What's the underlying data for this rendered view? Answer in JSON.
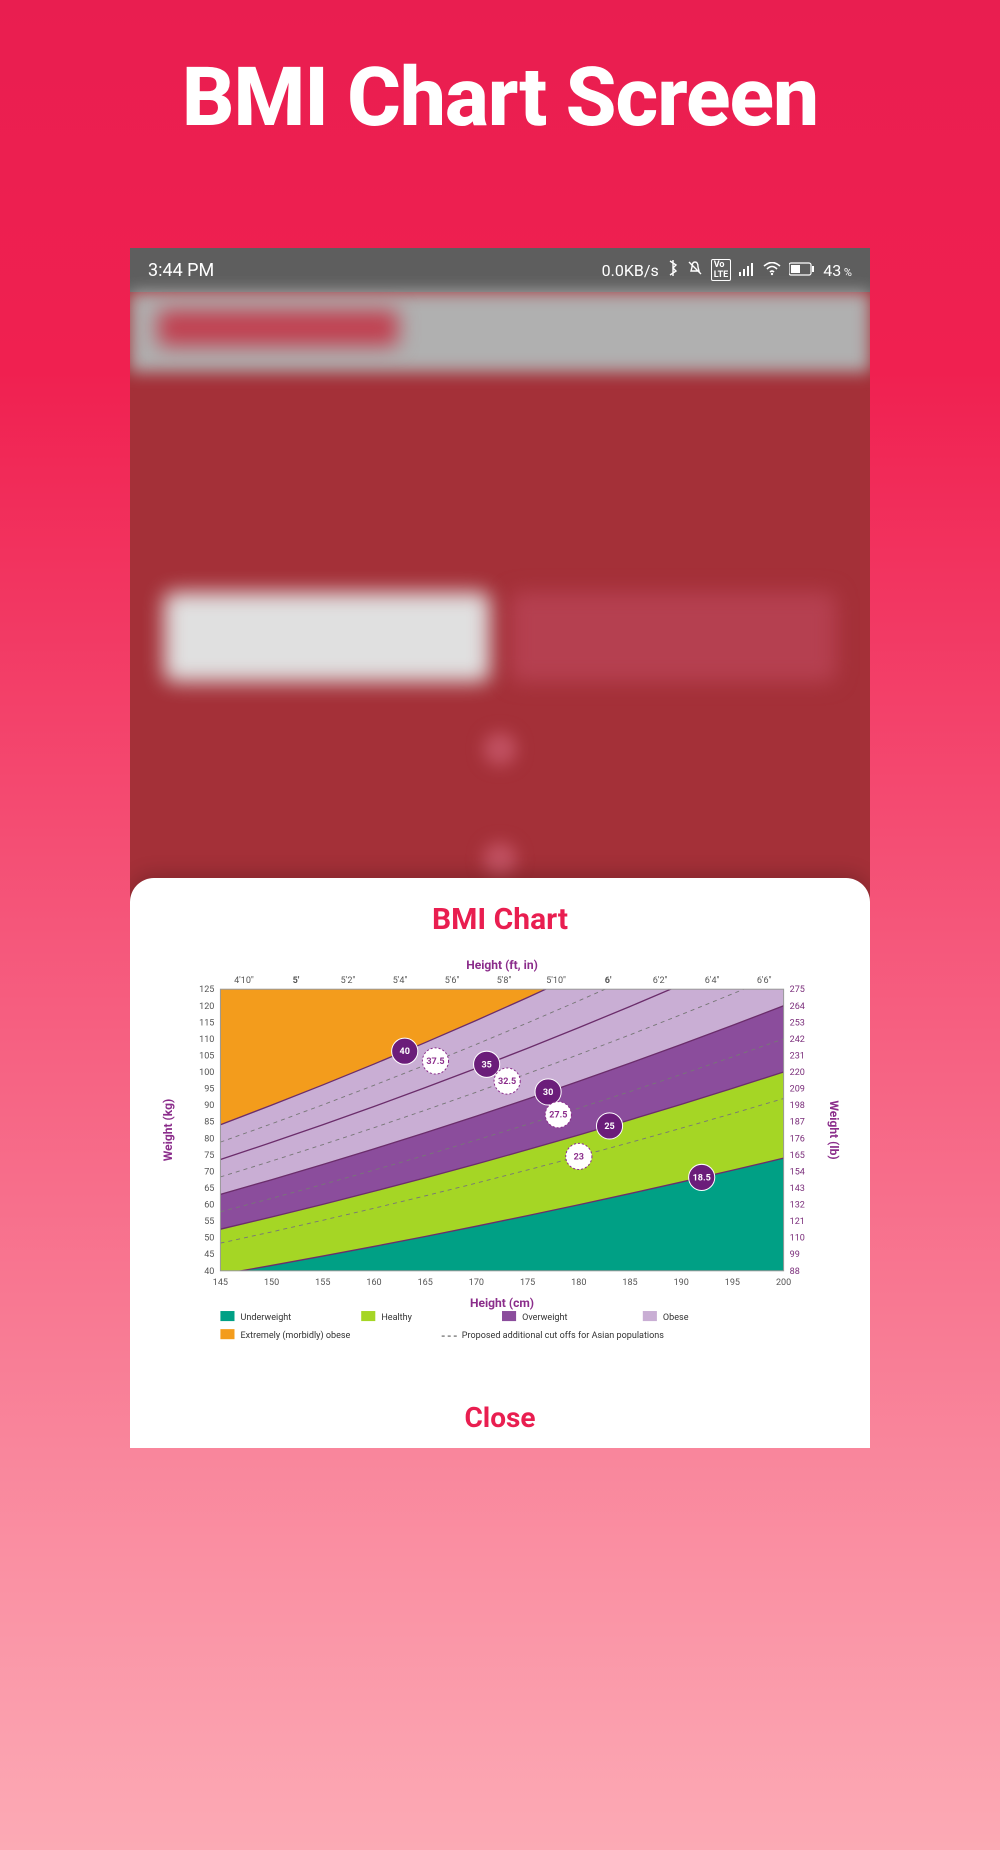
{
  "page": {
    "title": "BMI Chart Screen"
  },
  "status": {
    "time": "3:44 PM",
    "data_rate": "0.0KB/s",
    "battery": "43",
    "battery_suffix": " %"
  },
  "sheet": {
    "title": "BMI Chart",
    "close_label": "Close"
  },
  "chart_data": {
    "type": "area",
    "title": "BMI Chart",
    "x": {
      "label_top": "Height (ft, in)",
      "label_bottom": "Height (cm)",
      "lim_cm": [
        145,
        200
      ],
      "ticks_cm": [
        145,
        150,
        155,
        160,
        165,
        170,
        175,
        180,
        185,
        190,
        195,
        200
      ],
      "ticks_ftin": [
        "4'10\"",
        "5'",
        "5'2\"",
        "5'4\"",
        "5'6\"",
        "5'8\"",
        "5'10\"",
        "6'",
        "6'2\"",
        "6'4\"",
        "6'6\""
      ]
    },
    "y": {
      "label_left": "Weight (kg)",
      "label_right": "Weight (lb)",
      "lim_kg": [
        40,
        125
      ],
      "ticks_kg": [
        40,
        45,
        50,
        55,
        60,
        65,
        70,
        75,
        80,
        85,
        90,
        95,
        100,
        105,
        110,
        115,
        120,
        125
      ],
      "ticks_lb": [
        88,
        99,
        110,
        121,
        132,
        143,
        154,
        165,
        176,
        187,
        198,
        209,
        220,
        231,
        242,
        253,
        264,
        275
      ]
    },
    "bmi_lines": [
      18.5,
      23,
      25,
      27.5,
      30,
      32.5,
      35,
      37.5,
      40
    ],
    "bands": [
      {
        "name": "Underweight",
        "color": "#00a085",
        "bmi_max": 18.5
      },
      {
        "name": "Healthy",
        "color": "#a5d625",
        "bmi_min": 18.5,
        "bmi_max": 25
      },
      {
        "name": "Overweight",
        "color": "#8b4d9c",
        "bmi_min": 25,
        "bmi_max": 30
      },
      {
        "name": "Obese",
        "color": "#c9aed4",
        "bmi_min": 30,
        "bmi_max": 40
      },
      {
        "name": "Extremely (morbidly) obese",
        "color": "#f39c1c",
        "bmi_min": 40
      }
    ],
    "proposed_cutoffs": [
      23,
      27.5,
      32.5,
      37.5
    ],
    "bubbles": [
      {
        "value": 40,
        "filled": true
      },
      {
        "value": 37.5,
        "filled": false
      },
      {
        "value": 35,
        "filled": true
      },
      {
        "value": 32.5,
        "filled": false
      },
      {
        "value": 30,
        "filled": true
      },
      {
        "value": 27.5,
        "filled": false
      },
      {
        "value": 25,
        "filled": true
      },
      {
        "value": 23,
        "filled": false
      },
      {
        "value": 18.5,
        "filled": true
      }
    ],
    "legend": [
      {
        "swatch": "#00a085",
        "label": "Underweight"
      },
      {
        "swatch": "#a5d625",
        "label": "Healthy"
      },
      {
        "swatch": "#8b4d9c",
        "label": "Overweight"
      },
      {
        "swatch": "#c9aed4",
        "label": "Obese"
      },
      {
        "swatch": "#f39c1c",
        "label": "Extremely (morbidly) obese"
      },
      {
        "swatch": "dashed",
        "label": "Proposed additional cut offs for Asian populations"
      }
    ]
  }
}
